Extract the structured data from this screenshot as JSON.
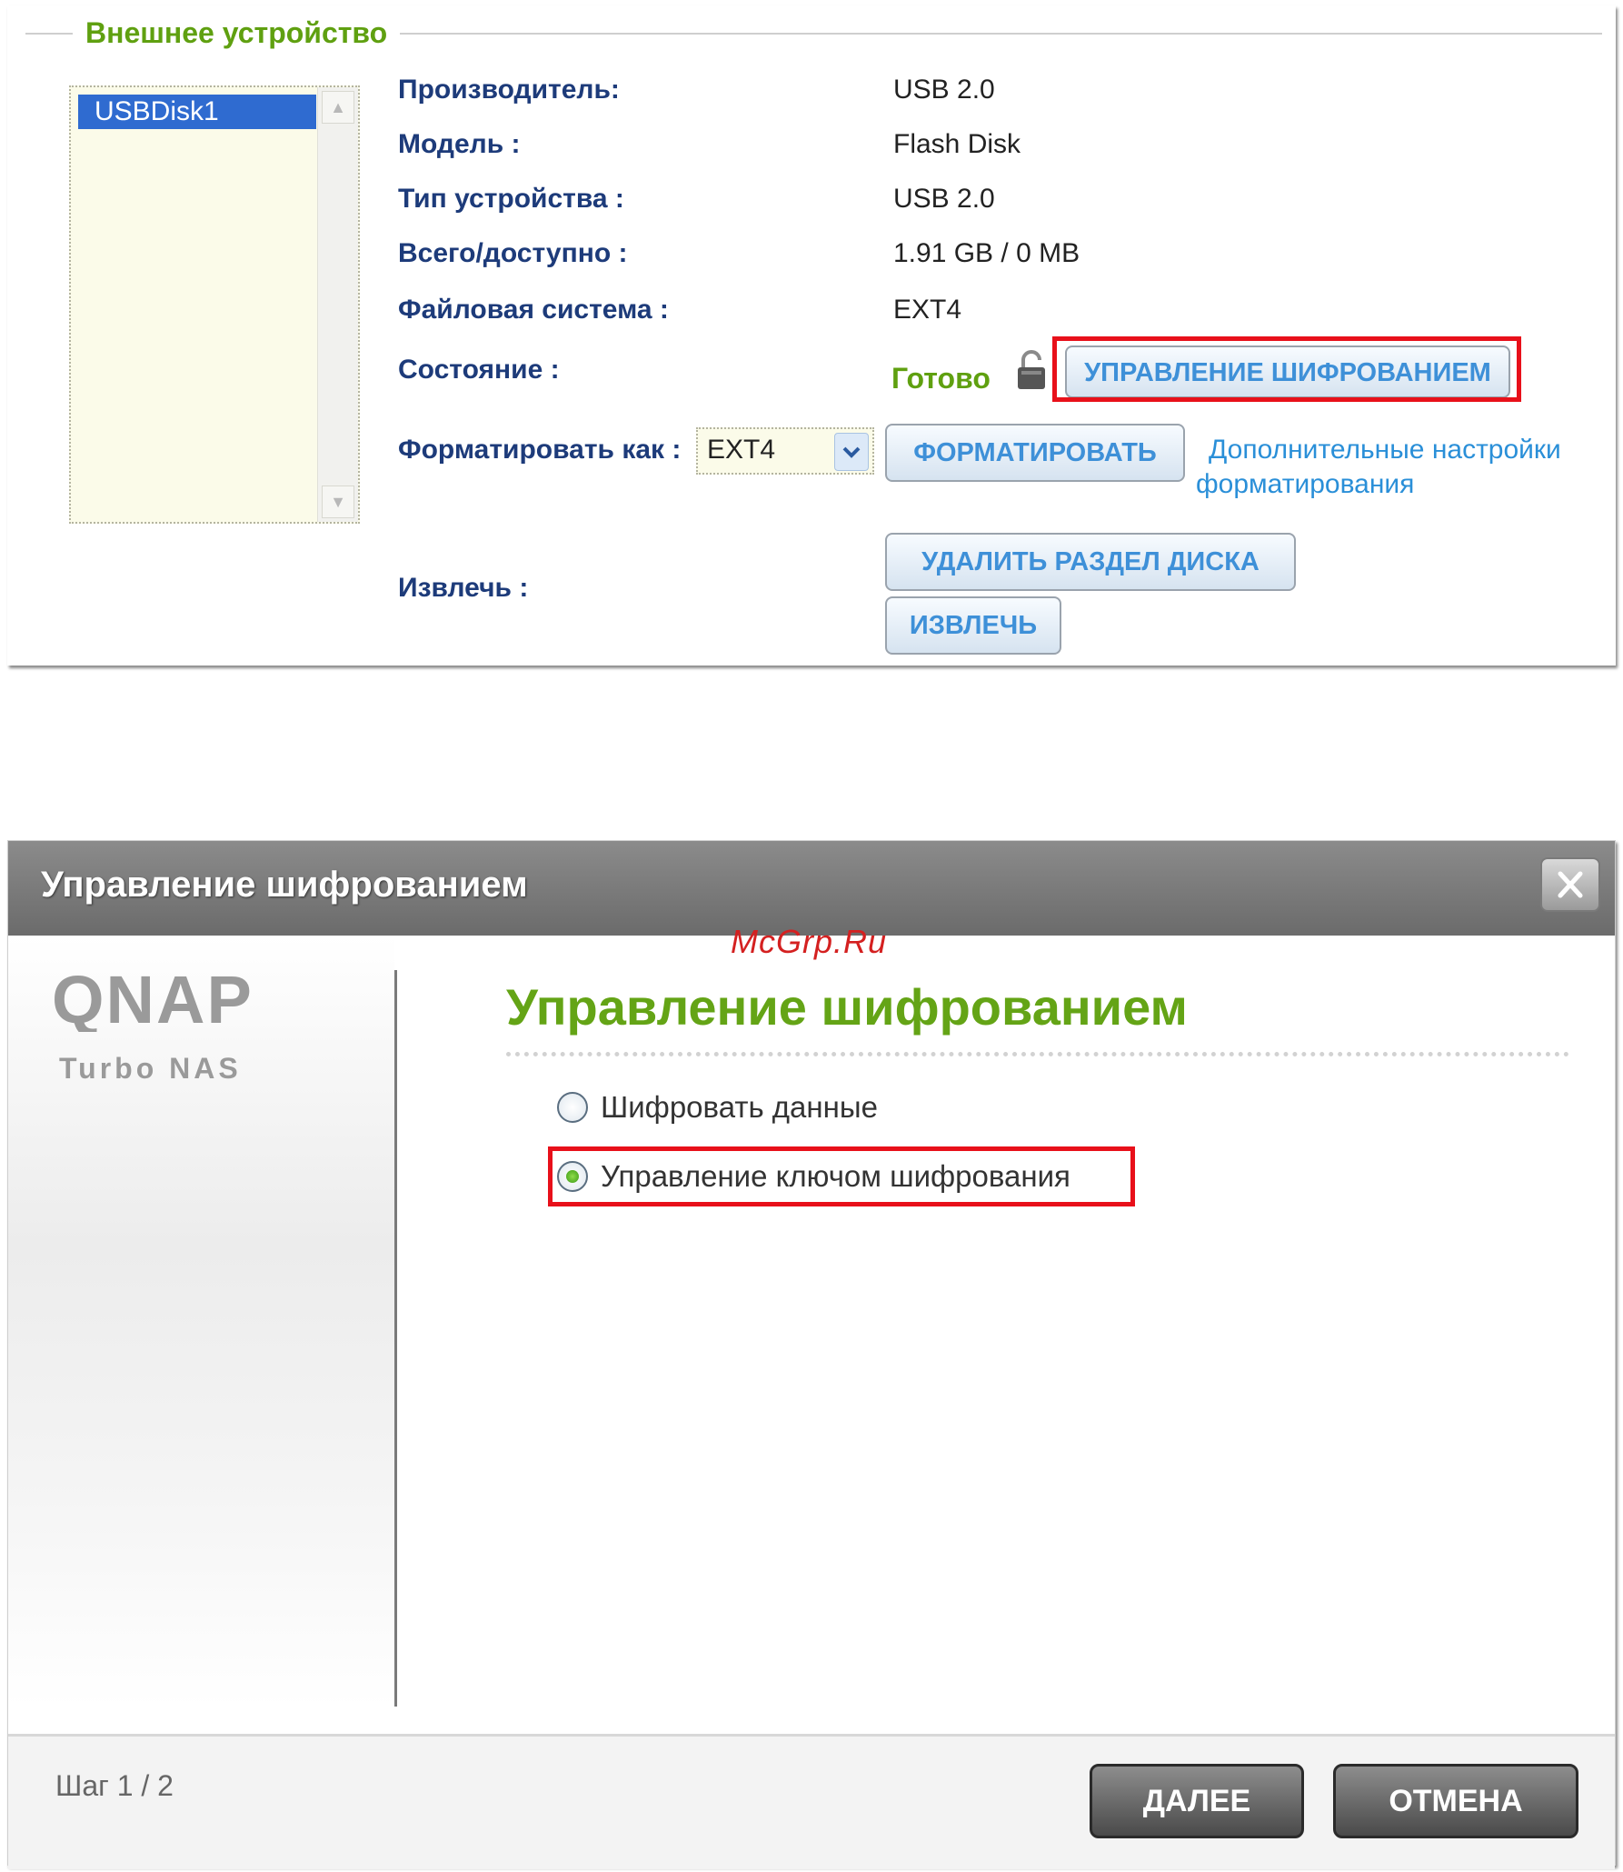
{
  "external_device": {
    "legend": "Внешнее устройство",
    "devices": [
      "USBDisk1"
    ],
    "fields": {
      "manufacturer_label": "Производитель:",
      "manufacturer_value": "USB 2.0",
      "model_label": "Модель :",
      "model_value": "Flash Disk",
      "device_type_label": "Тип устройства :",
      "device_type_value": "USB 2.0",
      "capacity_label": "Всего/доступно :",
      "capacity_value": "1.91 GB / 0 MB",
      "filesystem_label": "Файловая система :",
      "filesystem_value": "EXT4",
      "state_label": "Состояние :",
      "state_value": "Готово",
      "format_label": "Форматировать как :",
      "format_selected": "EXT4",
      "eject_label": "Извлечь :"
    },
    "buttons": {
      "encryption_mgmt": "УПРАВЛЕНИЕ ШИФРОВАНИЕМ",
      "format": "ФОРМАТИРОВАТЬ",
      "delete_partition": "УДАЛИТЬ РАЗДЕЛ ДИСКА",
      "eject": "ИЗВЛЕЧЬ"
    },
    "advanced_link_line1": "Дополнительные настройки",
    "advanced_link_line2": "форматирования",
    "colors": {
      "label": "#1d3b7a",
      "ready": "#5fa010",
      "highlight": "#e8101a",
      "link": "#2a8fd8"
    }
  },
  "dialog": {
    "title": "Управление шифрованием",
    "watermark": "McGrp.Ru",
    "logo_main": "QNAP",
    "logo_sub": "Turbo NAS",
    "heading": "Управление шифрованием",
    "options": [
      {
        "label": "Шифровать данные",
        "selected": false
      },
      {
        "label": "Управление ключом шифрования",
        "selected": true
      }
    ],
    "step": "Шаг 1 / 2",
    "next_button": "ДАЛЕЕ",
    "cancel_button": "ОТМЕНА",
    "colors": {
      "heading": "#64a416",
      "titlebar": "#7a7a7a"
    }
  }
}
